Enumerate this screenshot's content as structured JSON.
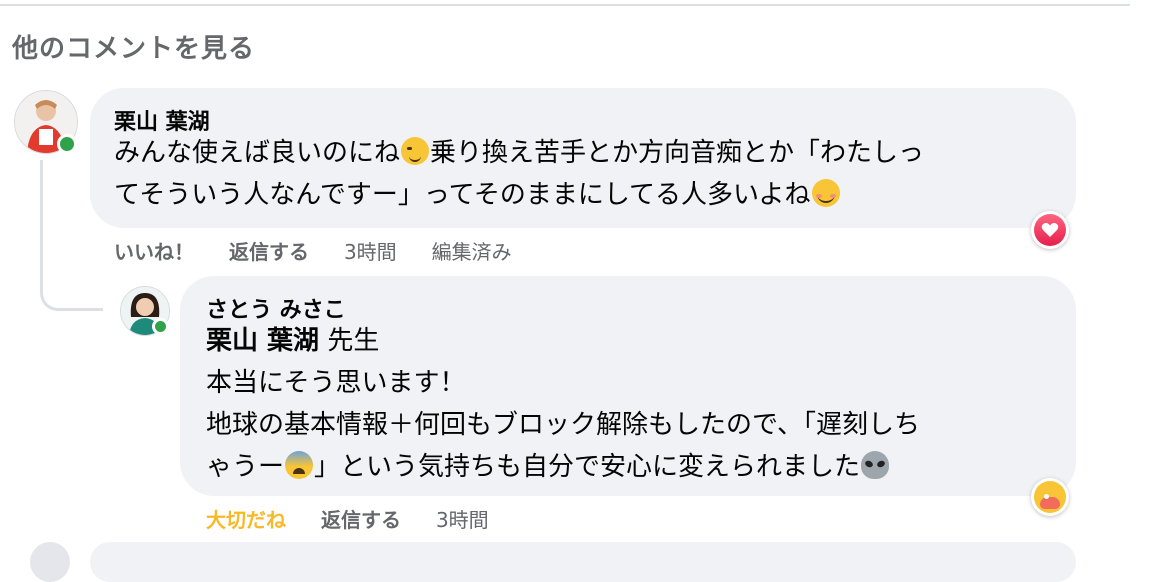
{
  "header": {
    "more_comments": "他のコメントを見る"
  },
  "comments": [
    {
      "author": "栗山 葉湖",
      "text_parts": [
        "みんな使えば良いのにね",
        "乗り換え苦手とか方向音痴とか「わたしっ",
        "てそういう人なんですー」ってそのままにしてる人多いよね"
      ],
      "actions": {
        "like": "いいね！",
        "reply": "返信する",
        "time": "3時間",
        "edited": "編集済み"
      },
      "reaction": "heart-icon"
    },
    {
      "author": "さとう みさこ",
      "mention": "栗山 葉湖",
      "mention_suffix": "先生",
      "lines": [
        "本当にそう思います！",
        "地球の基本情報＋何回もブロック解除もしたので、「遅刻しち",
        "ゃうー",
        "」という気持ちも自分で安心に変えられました"
      ],
      "actions": {
        "like": "大切だね",
        "reply": "返信する",
        "time": "3時間"
      },
      "reaction": "care-icon"
    }
  ],
  "colors": {
    "online": "#31a24c",
    "care_label": "#f7b928",
    "bubble": "#f0f2f5",
    "secondary_text": "#65676b"
  }
}
